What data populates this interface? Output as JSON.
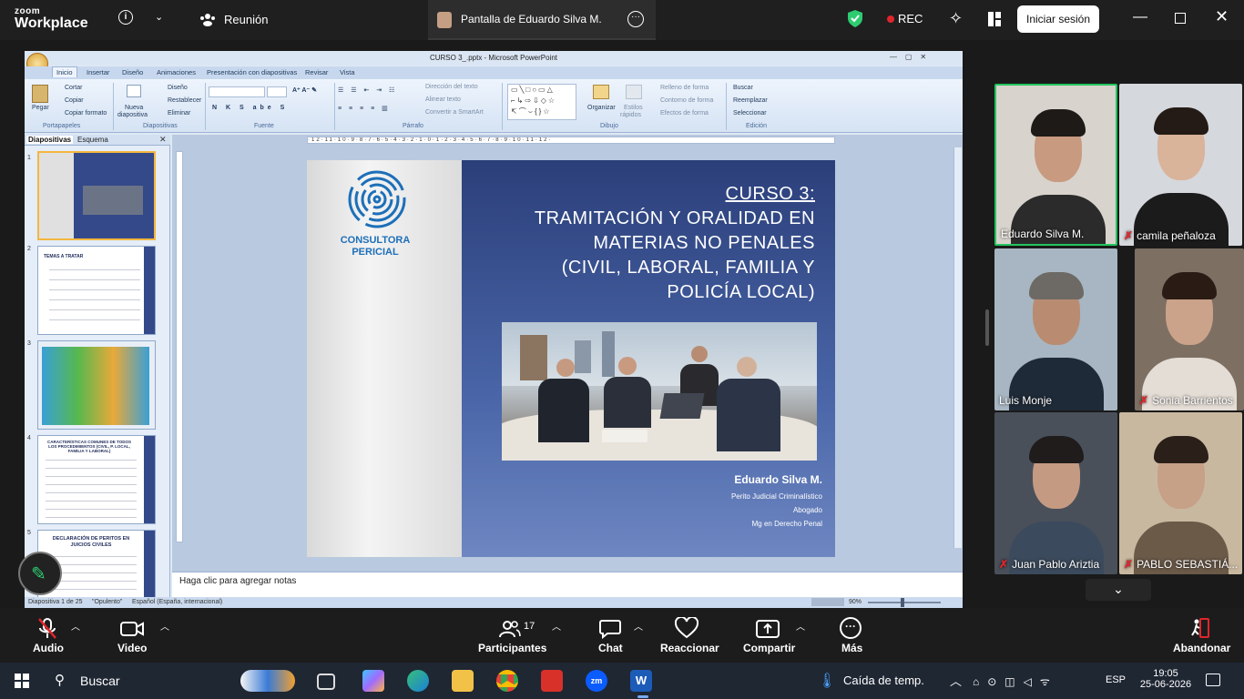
{
  "zoom": {
    "logo_line1": "zoom",
    "logo_line2": "Workplace",
    "meeting_title": "Reunión",
    "share_tab_title": "Pantalla de Eduardo Silva M.",
    "rec_label": "REC",
    "signin_label": "Iniciar sesión"
  },
  "ppt": {
    "window_title": "CURSO 3_.pptx - Microsoft PowerPoint",
    "tabs": [
      "Inicio",
      "Insertar",
      "Diseño",
      "Animaciones",
      "Presentación con diapositivas",
      "Revisar",
      "Vista"
    ],
    "ribbon": {
      "paste": "Pegar",
      "cut": "Cortar",
      "copy": "Copiar",
      "format_painter": "Copiar formato",
      "new_slide_1": "Nueva",
      "new_slide_2": "diapositiva",
      "layout": "Diseño",
      "reset": "Restablecer",
      "delete": "Eliminar",
      "text_direction": "Dirección del texto",
      "align_text": "Alinear texto",
      "smartart": "Convertir a SmartArt",
      "arrange": "Organizar",
      "quick_styles_1": "Estilos",
      "quick_styles_2": "rápidos",
      "shape_fill": "Relleno de forma",
      "shape_outline": "Contorno de forma",
      "shape_effects": "Efectos de forma",
      "find": "Buscar",
      "replace": "Reemplazar",
      "select": "Seleccionar",
      "group_clipboard": "Portapapeles",
      "group_slides": "Diapositivas",
      "group_font": "Fuente",
      "group_paragraph": "Párrafo",
      "group_drawing": "Dibujo",
      "group_editing": "Edición"
    },
    "pane_tabs": [
      "Diapositivas",
      "Esquema"
    ],
    "thumb_numbers": [
      "1",
      "2",
      "3",
      "4",
      "5"
    ],
    "thumb2_title": "TEMAS A TRATAR",
    "thumb4_title": "CARACTERÍSTICAS COMUNES DE TODOS LOS PROCEDIMIENTOS (CIVIL, P. LOCAL, FAMILIA Y LABORAL)",
    "thumb5_title": "DECLARACIÓN DE PERITOS EN JUICIOS CIVILES",
    "slide": {
      "logo_line1": "CONSULTORA",
      "logo_line2": "PERICIAL",
      "title_1": "CURSO 3:",
      "title_2": "TRAMITACIÓN Y ORALIDAD EN",
      "title_3": "MATERIAS NO PENALES",
      "title_4": "(CIVIL, LABORAL, FAMILIA Y",
      "title_5": "POLICÍA LOCAL)",
      "presenter": "Eduardo Silva M.",
      "role_1": "Perito Judicial Criminalístico",
      "role_2": "Abogado",
      "role_3": "Mg en Derecho Penal"
    },
    "notes_placeholder": "Haga clic para agregar notas",
    "status_slide": "Diapositiva 1 de 25",
    "status_theme": "\"Opulento\"",
    "status_lang": "Español (España, internacional)",
    "zoom_level": "90%"
  },
  "participants": [
    {
      "name": "Eduardo Silva M.",
      "muted": false,
      "skin": "#c89a80",
      "bg": "#d8d3cc",
      "hair": "#1d1a18",
      "shirt": "#2b2b2b"
    },
    {
      "name": "camila peñaloza",
      "muted": true,
      "skin": "#d9b39a",
      "bg": "#d5d8dc",
      "hair": "#241b16",
      "shirt": "#1b1b1b"
    },
    {
      "name": "Luis Monje",
      "muted": false,
      "skin": "#b98c72",
      "bg": "#a7b6c2",
      "hair": "#6d6964",
      "shirt": "#1f2a38"
    },
    {
      "name": "Sonia Barrientos",
      "muted": true,
      "skin": "#caa38a",
      "bg": "#7e6f63",
      "hair": "#2a1c15",
      "shirt": "#e4ddd5"
    },
    {
      "name": "Juan Pablo Ariztia",
      "muted": true,
      "skin": "#c49a82",
      "bg": "#49505a",
      "hair": "#1f1c1b",
      "shirt": "#3b4a5c"
    },
    {
      "name": "PABLO SEBASTIÁ...",
      "muted": true,
      "skin": "#c7a088",
      "bg": "#c9b8a0",
      "hair": "#2a2019",
      "shirt": "#6b5a48"
    }
  ],
  "toolbar": {
    "audio": "Audio",
    "video": "Video",
    "participants": "Participantes",
    "participants_count": "17",
    "chat": "Chat",
    "react": "Reaccionar",
    "share": "Compartir",
    "more": "Más",
    "leave": "Abandonar"
  },
  "taskbar": {
    "search": "Buscar",
    "weather": "Caída de temp.",
    "lang": "ESP",
    "time": "19:05",
    "date": "25-06-2026"
  },
  "colors": {
    "active_speaker_border": "#22c55e",
    "rec_dot": "#e0252b",
    "shield": "#2ecc71",
    "zoom_blue": "#0b5cff"
  }
}
